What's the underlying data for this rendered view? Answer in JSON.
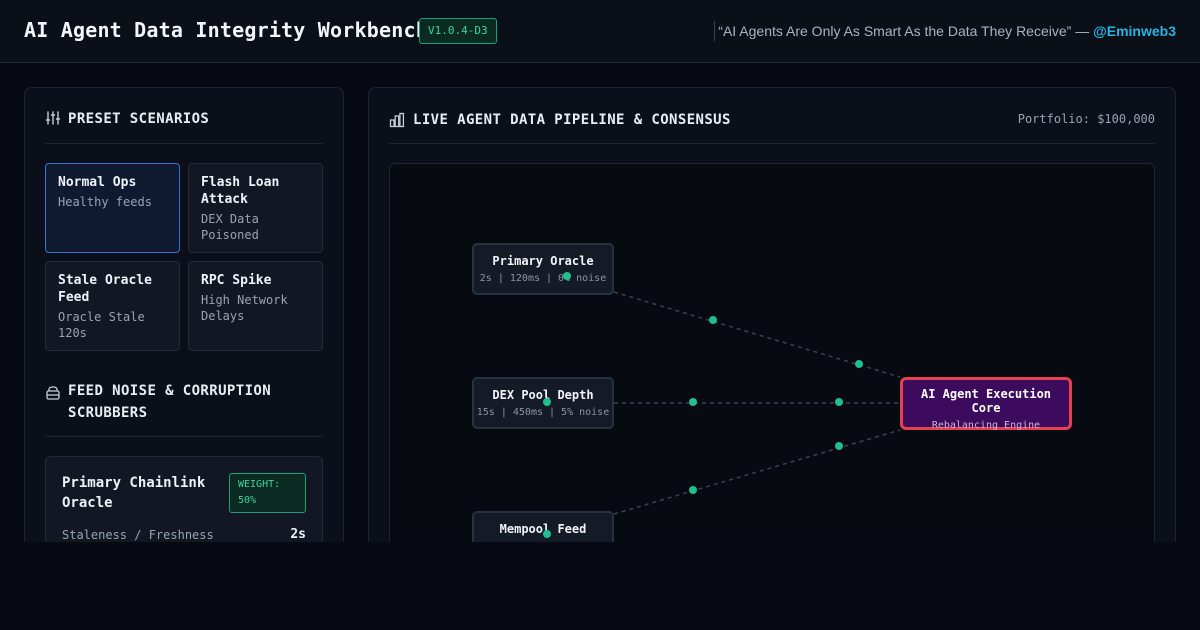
{
  "header": {
    "title": "AI Agent Data Integrity Workbench",
    "version": "V1.0.4-D3",
    "quote": "“AI Agents Are Only As Smart As the Data They Receive” —",
    "handle": "@Eminweb3"
  },
  "presets": {
    "title": "PRESET SCENARIOS",
    "items": [
      {
        "title": "Normal Ops",
        "subtitle": "Healthy feeds"
      },
      {
        "title": "Flash Loan Attack",
        "subtitle": "DEX Data Poisoned"
      },
      {
        "title": "Stale Oracle Feed",
        "subtitle": "Oracle Stale 120s"
      },
      {
        "title": "RPC Spike",
        "subtitle": "High Network Delays"
      }
    ]
  },
  "scrubbers": {
    "title": "FEED NOISE & CORRUPTION SCRUBBERS",
    "feed": {
      "name": "Primary Chainlink Oracle",
      "weight": "WEIGHT: 50%",
      "metric_label": "Staleness / Freshness",
      "metric_value": "2s"
    }
  },
  "pipeline": {
    "title": "LIVE AGENT DATA PIPELINE & CONSENSUS",
    "portfolio": "Portfolio: $100,000",
    "nodes": [
      {
        "title": "Primary Oracle",
        "subtitle": "2s | 120ms | 0% noise"
      },
      {
        "title": "DEX Pool Depth",
        "subtitle": "15s | 450ms | 5% noise"
      },
      {
        "title": "Mempool Feed",
        "subtitle": ""
      }
    ],
    "core": {
      "title": "AI Agent Execution Core",
      "subtitle": "Rebalancing Engine"
    }
  },
  "colors": {
    "accent": "#3fd39f",
    "core_border": "#e5414f",
    "core_bg": "#3d0b5e",
    "active_border": "#3b6fd4",
    "handle": "#2ab4e3"
  }
}
